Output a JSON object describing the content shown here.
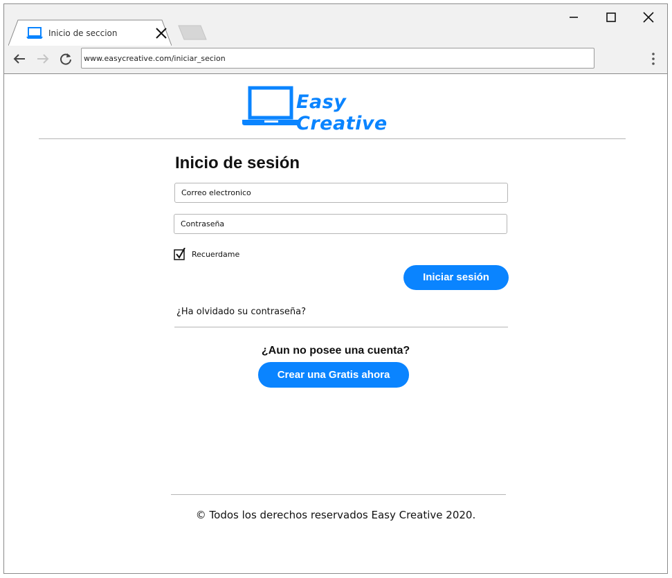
{
  "browser": {
    "tab_title": "Inicio de seccion",
    "url": "www.easycreative.com/iniciar_secion"
  },
  "logo": {
    "text": "Easy Creative",
    "icon": "laptop-icon",
    "color": "#0a84ff"
  },
  "login": {
    "title": "Inicio de sesión",
    "email_value": "Correo electronico",
    "password_value": "Contraseña",
    "remember_label": "Recuerdame",
    "remember_checked": true,
    "submit_label": "Iniciar sesión",
    "forgot_label": "¿Ha olvidado su contraseña?"
  },
  "signup": {
    "prompt": "¿Aun no posee una cuenta?",
    "button_label": "Crear una Gratis ahora"
  },
  "footer": {
    "text": "© Todos los derechos reservados Easy Creative 2020."
  },
  "colors": {
    "accent": "#0a84ff",
    "chrome": "#f1f1f1"
  }
}
